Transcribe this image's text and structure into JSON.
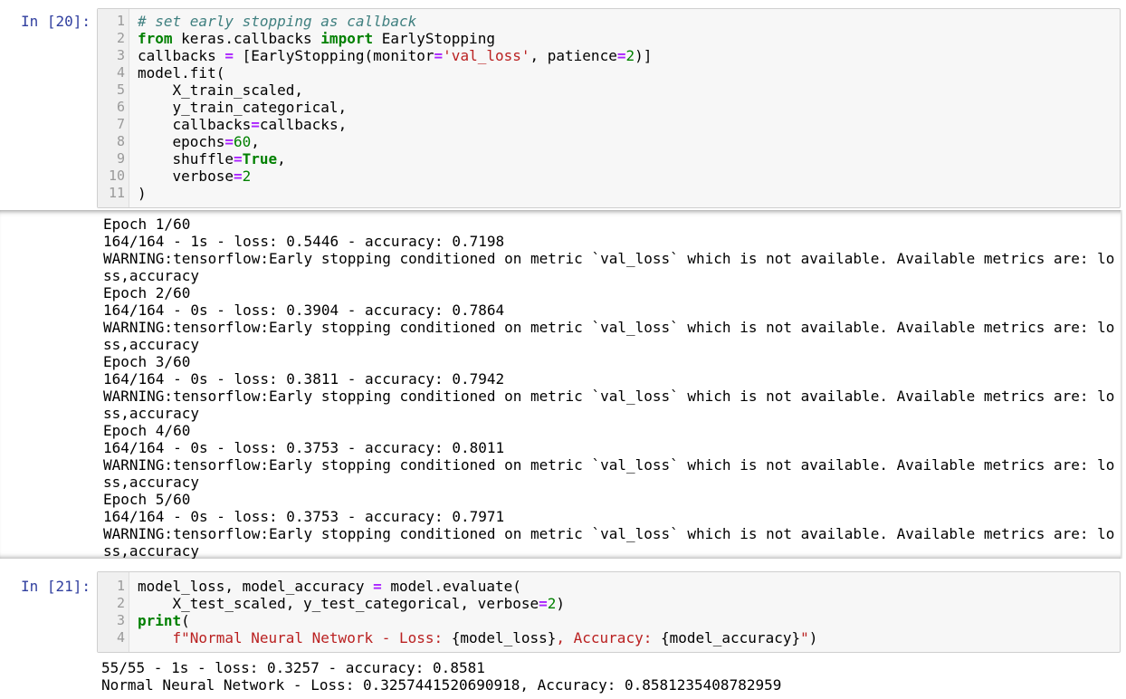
{
  "cells": [
    {
      "prompt": "In [20]:",
      "code": [
        {
          "n": "1",
          "tokens": [
            {
              "t": "# set early stopping as callback",
              "c": "cm"
            }
          ]
        },
        {
          "n": "2",
          "tokens": [
            {
              "t": "from",
              "c": "kw"
            },
            {
              "t": " keras.callbacks ",
              "c": ""
            },
            {
              "t": "import",
              "c": "kw"
            },
            {
              "t": " EarlyStopping",
              "c": ""
            }
          ]
        },
        {
          "n": "3",
          "tokens": [
            {
              "t": "callbacks ",
              "c": ""
            },
            {
              "t": "=",
              "c": "op"
            },
            {
              "t": " [EarlyStopping(monitor",
              "c": ""
            },
            {
              "t": "=",
              "c": "op"
            },
            {
              "t": "'val_loss'",
              "c": "st"
            },
            {
              "t": ", patience",
              "c": ""
            },
            {
              "t": "=",
              "c": "op"
            },
            {
              "t": "2",
              "c": "nu"
            },
            {
              "t": ")]",
              "c": ""
            }
          ]
        },
        {
          "n": "4",
          "tokens": [
            {
              "t": "model.fit(",
              "c": ""
            }
          ]
        },
        {
          "n": "5",
          "tokens": [
            {
              "t": "    X_train_scaled,",
              "c": ""
            }
          ]
        },
        {
          "n": "6",
          "tokens": [
            {
              "t": "    y_train_categorical,",
              "c": ""
            }
          ]
        },
        {
          "n": "7",
          "tokens": [
            {
              "t": "    callbacks",
              "c": ""
            },
            {
              "t": "=",
              "c": "op"
            },
            {
              "t": "callbacks,",
              "c": ""
            }
          ]
        },
        {
          "n": "8",
          "tokens": [
            {
              "t": "    epochs",
              "c": ""
            },
            {
              "t": "=",
              "c": "op"
            },
            {
              "t": "60",
              "c": "nu"
            },
            {
              "t": ",",
              "c": ""
            }
          ]
        },
        {
          "n": "9",
          "tokens": [
            {
              "t": "    shuffle",
              "c": ""
            },
            {
              "t": "=",
              "c": "op"
            },
            {
              "t": "True",
              "c": "kw"
            },
            {
              "t": ",",
              "c": ""
            }
          ]
        },
        {
          "n": "10",
          "tokens": [
            {
              "t": "    verbose",
              "c": ""
            },
            {
              "t": "=",
              "c": "op"
            },
            {
              "t": "2",
              "c": "nu"
            }
          ]
        },
        {
          "n": "11",
          "tokens": [
            {
              "t": ")",
              "c": ""
            }
          ]
        }
      ],
      "output": [
        "Epoch 1/60",
        "164/164 - 1s - loss: 0.5446 - accuracy: 0.7198",
        "WARNING:tensorflow:Early stopping conditioned on metric `val_loss` which is not available. Available metrics are: lo",
        "ss,accuracy",
        "Epoch 2/60",
        "164/164 - 0s - loss: 0.3904 - accuracy: 0.7864",
        "WARNING:tensorflow:Early stopping conditioned on metric `val_loss` which is not available. Available metrics are: lo",
        "ss,accuracy",
        "Epoch 3/60",
        "164/164 - 0s - loss: 0.3811 - accuracy: 0.7942",
        "WARNING:tensorflow:Early stopping conditioned on metric `val_loss` which is not available. Available metrics are: lo",
        "ss,accuracy",
        "Epoch 4/60",
        "164/164 - 0s - loss: 0.3753 - accuracy: 0.8011",
        "WARNING:tensorflow:Early stopping conditioned on metric `val_loss` which is not available. Available metrics are: lo",
        "ss,accuracy",
        "Epoch 5/60",
        "164/164 - 0s - loss: 0.3753 - accuracy: 0.7971",
        "WARNING:tensorflow:Early stopping conditioned on metric `val_loss` which is not available. Available metrics are: lo",
        "ss,accuracy"
      ]
    },
    {
      "prompt": "In [21]:",
      "code": [
        {
          "n": "1",
          "tokens": [
            {
              "t": "model_loss, model_accuracy ",
              "c": ""
            },
            {
              "t": "=",
              "c": "op"
            },
            {
              "t": " model.evaluate(",
              "c": ""
            }
          ]
        },
        {
          "n": "2",
          "tokens": [
            {
              "t": "    X_test_scaled, y_test_categorical, verbose",
              "c": ""
            },
            {
              "t": "=",
              "c": "op"
            },
            {
              "t": "2",
              "c": "nu"
            },
            {
              "t": ")",
              "c": ""
            }
          ]
        },
        {
          "n": "3",
          "tokens": [
            {
              "t": "print",
              "c": "kw"
            },
            {
              "t": "(",
              "c": ""
            }
          ]
        },
        {
          "n": "4",
          "tokens": [
            {
              "t": "    f\"Normal Neural Network - Loss: ",
              "c": "st"
            },
            {
              "t": "{model_loss}",
              "c": ""
            },
            {
              "t": ", Accuracy: ",
              "c": "st"
            },
            {
              "t": "{model_accuracy}",
              "c": ""
            },
            {
              "t": "\"",
              "c": "st"
            },
            {
              "t": ")",
              "c": ""
            }
          ]
        }
      ],
      "output": [
        "55/55 - 1s - loss: 0.3257 - accuracy: 0.8581",
        "Normal Neural Network - Loss: 0.3257441520690918, Accuracy: 0.8581235408782959"
      ]
    }
  ]
}
